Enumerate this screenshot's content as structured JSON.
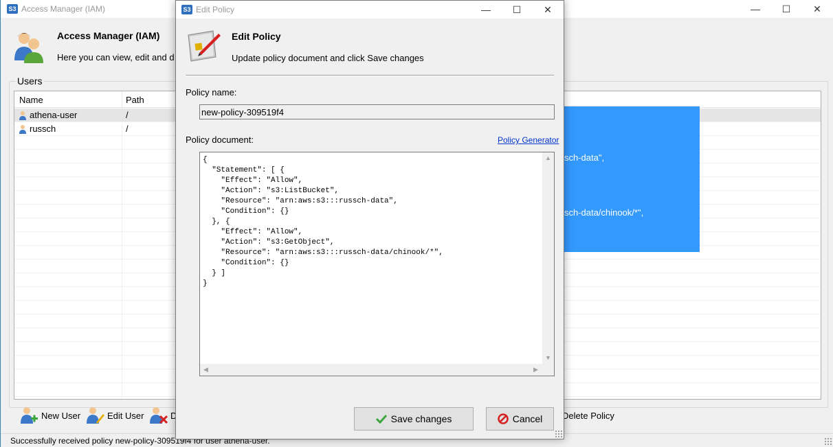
{
  "main_window": {
    "app_badge": "S3",
    "title": "Access Manager (IAM)",
    "header": {
      "title": "Access Manager (IAM)",
      "subtitle": "Here you can view, edit and de"
    },
    "users_group_label": "Users",
    "columns": [
      "Name",
      "Path"
    ],
    "users": [
      {
        "name": "athena-user",
        "path": "/"
      },
      {
        "name": "russch",
        "path": "/"
      }
    ],
    "policy_preview_lines": [
      "sch-data\",",
      "sch-data/chinook/*\","
    ],
    "toolbar": {
      "new_user": "New User",
      "edit_user": "Edit User",
      "delete_user_partial": "D",
      "delete_policy": "Delete Policy"
    },
    "status": "Successfully received policy new-policy-309519f4 for user athena-user."
  },
  "dialog": {
    "app_badge": "S3",
    "title": "Edit Policy",
    "heading": "Edit Policy",
    "subheading": "Update policy document and click Save changes",
    "policy_name_label": "Policy name:",
    "policy_name_value": "new-policy-309519f4",
    "policy_document_label": "Policy document:",
    "policy_generator_link": "Policy Generator",
    "policy_document": "{\n  \"Statement\": [ {\n    \"Effect\": \"Allow\",\n    \"Action\": \"s3:ListBucket\",\n    \"Resource\": \"arn:aws:s3:::russch-data\",\n    \"Condition\": {}\n  }, {\n    \"Effect\": \"Allow\",\n    \"Action\": \"s3:GetObject\",\n    \"Resource\": \"arn:aws:s3:::russch-data/chinook/*\",\n    \"Condition\": {}\n  } ]\n}",
    "save_label": "Save changes",
    "cancel_label": "Cancel"
  },
  "colors": {
    "selection_blue": "#3399ff",
    "link": "#0033cc",
    "save_check": "#3aa53a",
    "cancel_red": "#d62020"
  }
}
